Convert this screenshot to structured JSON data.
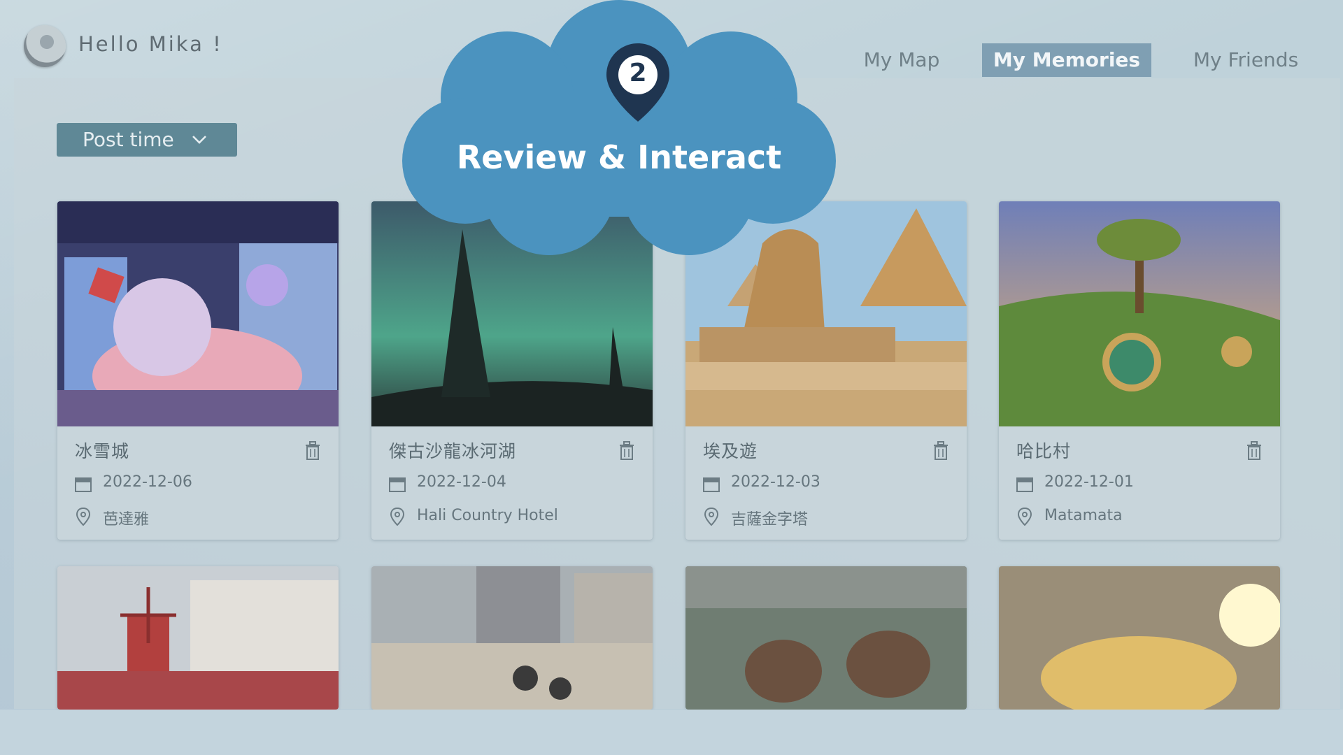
{
  "header": {
    "greeting": "Hello Mika !",
    "nav": [
      {
        "label": "My Map",
        "active": false
      },
      {
        "label": "My Memories",
        "active": true
      },
      {
        "label": "My Friends",
        "active": false
      }
    ]
  },
  "sort": {
    "label": "Post time"
  },
  "overlay": {
    "step": "2",
    "title": "Review & Interact"
  },
  "cards": [
    {
      "title": "冰雪城",
      "date": "2022-12-06",
      "location": "芭達雅"
    },
    {
      "title": "傑古沙龍冰河湖",
      "date": "2022-12-04",
      "location": "Hali Country Hotel"
    },
    {
      "title": "埃及遊",
      "date": "2022-12-03",
      "location": "吉薩金字塔"
    },
    {
      "title": "哈比村",
      "date": "2022-12-01",
      "location": "Matamata"
    }
  ],
  "colors": {
    "accent": "#5f8896",
    "nav_active": "#7f9fb3",
    "cloud": "#4b93bf",
    "pin": "#1f3550"
  }
}
